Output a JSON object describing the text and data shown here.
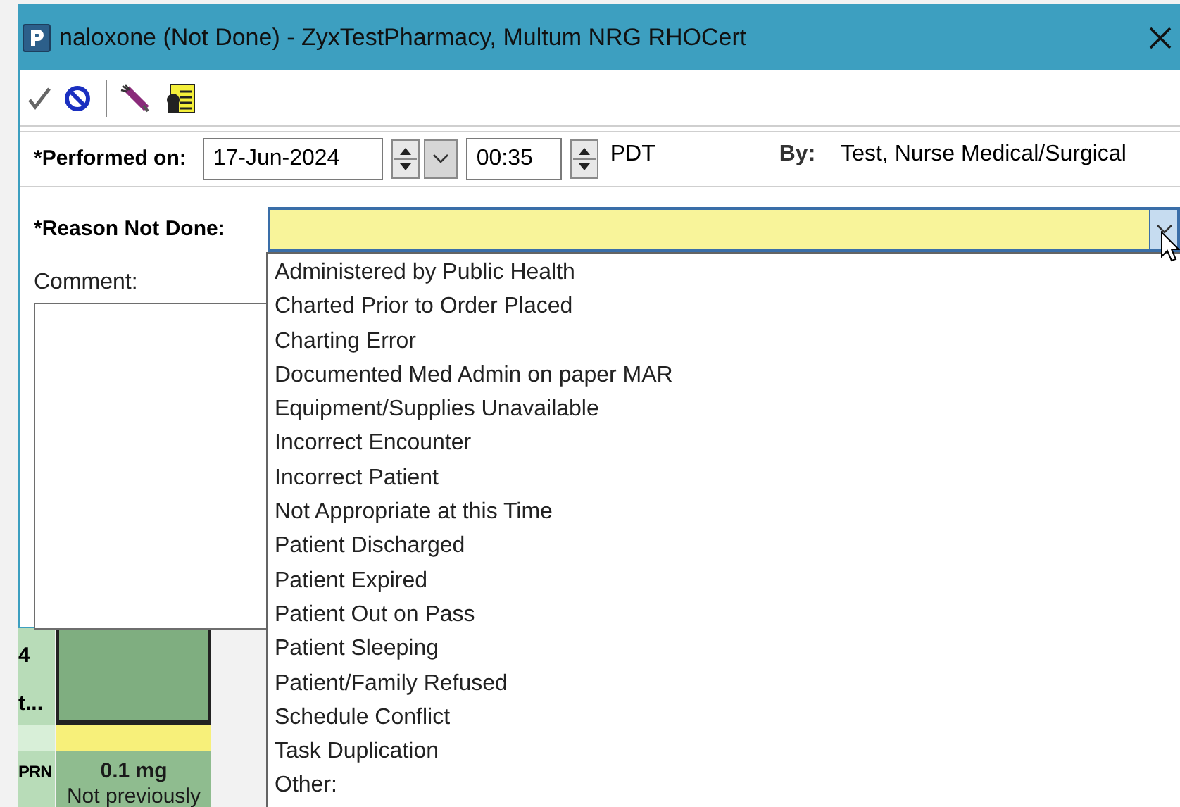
{
  "window": {
    "title": "naloxone (Not Done) - ZyxTestPharmacy, Multum NRG RHOCert"
  },
  "performed": {
    "label": "*Performed on:",
    "date": "17-Jun-2024",
    "time": "00:35",
    "timezone": "PDT",
    "by_label": "By:",
    "by_value": "Test, Nurse Medical/Surgical"
  },
  "reason": {
    "label": "*Reason Not Done:",
    "expanded": true,
    "options": [
      {
        "label": "Administered by Public Health",
        "selected": false
      },
      {
        "label": "Charted Prior to Order Placed",
        "selected": false
      },
      {
        "label": "Charting Error",
        "selected": false
      },
      {
        "label": "Documented Med Admin on paper MAR",
        "selected": false
      },
      {
        "label": "Equipment/Supplies Unavailable",
        "selected": false
      },
      {
        "label": "Incorrect Encounter",
        "selected": false
      },
      {
        "label": "Incorrect Patient",
        "selected": false
      },
      {
        "label": "Not Appropriate at this Time",
        "selected": false
      },
      {
        "label": "Patient Discharged",
        "selected": false
      },
      {
        "label": "Patient Expired",
        "selected": false
      },
      {
        "label": "Patient Out on Pass",
        "selected": false
      },
      {
        "label": "Patient Sleeping",
        "selected": false
      },
      {
        "label": "Patient/Family Refused",
        "selected": false
      },
      {
        "label": "Schedule Conflict",
        "selected": false
      },
      {
        "label": "Task Duplication",
        "selected": false
      },
      {
        "label": "Other:",
        "selected": false
      }
    ]
  },
  "comment": {
    "label": "Comment:"
  },
  "background_grid": {
    "row_label_1": "4",
    "row_label_2": "t...",
    "row_label_3": "PRN",
    "dose": "0.1 mg",
    "dose_note": "Not previously"
  }
}
